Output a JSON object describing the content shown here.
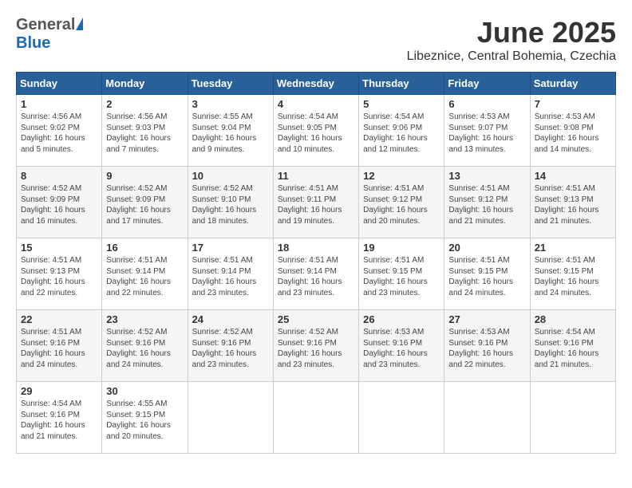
{
  "header": {
    "logo_general": "General",
    "logo_blue": "Blue",
    "month_year": "June 2025",
    "location": "Libeznice, Central Bohemia, Czechia"
  },
  "days_of_week": [
    "Sunday",
    "Monday",
    "Tuesday",
    "Wednesday",
    "Thursday",
    "Friday",
    "Saturday"
  ],
  "weeks": [
    [
      {
        "day": "1",
        "sunrise": "4:56 AM",
        "sunset": "9:02 PM",
        "daylight": "16 hours and 5 minutes."
      },
      {
        "day": "2",
        "sunrise": "4:56 AM",
        "sunset": "9:03 PM",
        "daylight": "16 hours and 7 minutes."
      },
      {
        "day": "3",
        "sunrise": "4:55 AM",
        "sunset": "9:04 PM",
        "daylight": "16 hours and 9 minutes."
      },
      {
        "day": "4",
        "sunrise": "4:54 AM",
        "sunset": "9:05 PM",
        "daylight": "16 hours and 10 minutes."
      },
      {
        "day": "5",
        "sunrise": "4:54 AM",
        "sunset": "9:06 PM",
        "daylight": "16 hours and 12 minutes."
      },
      {
        "day": "6",
        "sunrise": "4:53 AM",
        "sunset": "9:07 PM",
        "daylight": "16 hours and 13 minutes."
      },
      {
        "day": "7",
        "sunrise": "4:53 AM",
        "sunset": "9:08 PM",
        "daylight": "16 hours and 14 minutes."
      }
    ],
    [
      {
        "day": "8",
        "sunrise": "4:52 AM",
        "sunset": "9:09 PM",
        "daylight": "16 hours and 16 minutes."
      },
      {
        "day": "9",
        "sunrise": "4:52 AM",
        "sunset": "9:09 PM",
        "daylight": "16 hours and 17 minutes."
      },
      {
        "day": "10",
        "sunrise": "4:52 AM",
        "sunset": "9:10 PM",
        "daylight": "16 hours and 18 minutes."
      },
      {
        "day": "11",
        "sunrise": "4:51 AM",
        "sunset": "9:11 PM",
        "daylight": "16 hours and 19 minutes."
      },
      {
        "day": "12",
        "sunrise": "4:51 AM",
        "sunset": "9:12 PM",
        "daylight": "16 hours and 20 minutes."
      },
      {
        "day": "13",
        "sunrise": "4:51 AM",
        "sunset": "9:12 PM",
        "daylight": "16 hours and 21 minutes."
      },
      {
        "day": "14",
        "sunrise": "4:51 AM",
        "sunset": "9:13 PM",
        "daylight": "16 hours and 21 minutes."
      }
    ],
    [
      {
        "day": "15",
        "sunrise": "4:51 AM",
        "sunset": "9:13 PM",
        "daylight": "16 hours and 22 minutes."
      },
      {
        "day": "16",
        "sunrise": "4:51 AM",
        "sunset": "9:14 PM",
        "daylight": "16 hours and 22 minutes."
      },
      {
        "day": "17",
        "sunrise": "4:51 AM",
        "sunset": "9:14 PM",
        "daylight": "16 hours and 23 minutes."
      },
      {
        "day": "18",
        "sunrise": "4:51 AM",
        "sunset": "9:14 PM",
        "daylight": "16 hours and 23 minutes."
      },
      {
        "day": "19",
        "sunrise": "4:51 AM",
        "sunset": "9:15 PM",
        "daylight": "16 hours and 23 minutes."
      },
      {
        "day": "20",
        "sunrise": "4:51 AM",
        "sunset": "9:15 PM",
        "daylight": "16 hours and 24 minutes."
      },
      {
        "day": "21",
        "sunrise": "4:51 AM",
        "sunset": "9:15 PM",
        "daylight": "16 hours and 24 minutes."
      }
    ],
    [
      {
        "day": "22",
        "sunrise": "4:51 AM",
        "sunset": "9:16 PM",
        "daylight": "16 hours and 24 minutes."
      },
      {
        "day": "23",
        "sunrise": "4:52 AM",
        "sunset": "9:16 PM",
        "daylight": "16 hours and 24 minutes."
      },
      {
        "day": "24",
        "sunrise": "4:52 AM",
        "sunset": "9:16 PM",
        "daylight": "16 hours and 23 minutes."
      },
      {
        "day": "25",
        "sunrise": "4:52 AM",
        "sunset": "9:16 PM",
        "daylight": "16 hours and 23 minutes."
      },
      {
        "day": "26",
        "sunrise": "4:53 AM",
        "sunset": "9:16 PM",
        "daylight": "16 hours and 23 minutes."
      },
      {
        "day": "27",
        "sunrise": "4:53 AM",
        "sunset": "9:16 PM",
        "daylight": "16 hours and 22 minutes."
      },
      {
        "day": "28",
        "sunrise": "4:54 AM",
        "sunset": "9:16 PM",
        "daylight": "16 hours and 21 minutes."
      }
    ],
    [
      {
        "day": "29",
        "sunrise": "4:54 AM",
        "sunset": "9:16 PM",
        "daylight": "16 hours and 21 minutes."
      },
      {
        "day": "30",
        "sunrise": "4:55 AM",
        "sunset": "9:15 PM",
        "daylight": "16 hours and 20 minutes."
      },
      null,
      null,
      null,
      null,
      null
    ]
  ]
}
